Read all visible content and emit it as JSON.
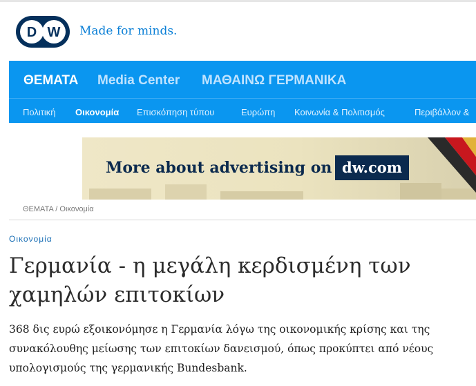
{
  "header": {
    "logo_text": "DW",
    "tagline": "Made for minds."
  },
  "nav": {
    "main": [
      {
        "label": "ΘΕΜΑΤΑ",
        "active": true
      },
      {
        "label": "Media Center",
        "active": false
      },
      {
        "label": "ΜΑΘΑΙΝΩ ΓΕΡΜΑΝΙΚΑ",
        "active": false
      }
    ],
    "sub": [
      {
        "label": "Πολιτική"
      },
      {
        "label": "Οικονομία",
        "current": true
      },
      {
        "label": "Επισκόπηση τύπου"
      },
      {
        "label": "Ευρώπη"
      },
      {
        "label": "Κοινωνία & Πολιτισμός"
      },
      {
        "label": "Περιβάλλον &"
      }
    ]
  },
  "ad": {
    "text": "More about advertising on",
    "badge": "dw.com"
  },
  "breadcrumb": {
    "items": [
      "ΘΕΜΑΤΑ",
      "Οικονομία"
    ],
    "separator": "/"
  },
  "article": {
    "kicker": "Οικονομία",
    "headline": "Γερμανία - η μεγάλη κερδισμένη των χαμηλών επιτοκίων",
    "lead": "368 δις ευρώ εξοικονόμησε η Γερμανία λόγω της οικονομικής κρίσης και της συνακόλουθης μείωσης των επιτοκίων δανεισμού, όπως προκύπτει από νέους υπολογισμούς της γερμανικής Bundesbank."
  },
  "colors": {
    "brand_blue": "#0a96f0",
    "navy": "#0b2a4e",
    "link_blue": "#1a6fb5"
  }
}
